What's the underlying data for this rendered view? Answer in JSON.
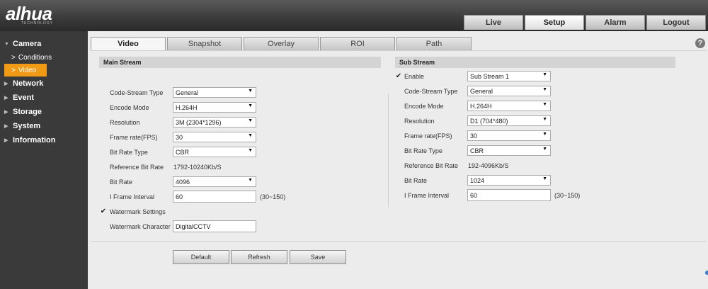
{
  "brand": {
    "name": "alhua",
    "subtitle": "TECHNOLOGY"
  },
  "topnav": [
    "Live",
    "Setup",
    "Alarm",
    "Logout"
  ],
  "sidebar": {
    "camera": "Camera",
    "conditions": "Conditions",
    "video": "Video",
    "network": "Network",
    "event": "Event",
    "storage": "Storage",
    "system": "System",
    "information": "Information"
  },
  "subtabs": [
    "Video",
    "Snapshot",
    "Overlay",
    "ROI",
    "Path"
  ],
  "help": "?",
  "main": {
    "title": "Main Stream",
    "code_stream_type": {
      "label": "Code-Stream Type",
      "value": "General"
    },
    "encode_mode": {
      "label": "Encode Mode",
      "value": "H.264H"
    },
    "resolution": {
      "label": "Resolution",
      "value": "3M (2304*1296)"
    },
    "frame_rate": {
      "label": "Frame rate(FPS)",
      "value": "30"
    },
    "bit_rate_type": {
      "label": "Bit Rate Type",
      "value": "CBR"
    },
    "reference_bit_rate": {
      "label": "Reference Bit Rate",
      "value": "1792-10240Kb/S"
    },
    "bit_rate": {
      "label": "Bit Rate",
      "value": "4096"
    },
    "i_frame": {
      "label": "I Frame Interval",
      "value": "60",
      "hint": "(30~150)"
    },
    "watermark_settings": "Watermark Settings",
    "watermark_character": {
      "label": "Watermark Character",
      "value": "DigitalCCTV"
    }
  },
  "sub": {
    "title": "Sub Stream",
    "enable": {
      "label": "Enable",
      "value": "Sub Stream 1"
    },
    "code_stream_type": {
      "label": "Code-Stream Type",
      "value": "General"
    },
    "encode_mode": {
      "label": "Encode Mode",
      "value": "H.264H"
    },
    "resolution": {
      "label": "Resolution",
      "value": "D1 (704*480)"
    },
    "frame_rate": {
      "label": "Frame rate(FPS)",
      "value": "30"
    },
    "bit_rate_type": {
      "label": "Bit Rate Type",
      "value": "CBR"
    },
    "reference_bit_rate": {
      "label": "Reference Bit Rate",
      "value": "192-4096Kb/S"
    },
    "bit_rate": {
      "label": "Bit Rate",
      "value": "1024"
    },
    "i_frame": {
      "label": "I Frame Interval",
      "value": "60",
      "hint": "(30~150)"
    }
  },
  "buttons": {
    "default": "Default",
    "refresh": "Refresh",
    "save": "Save"
  },
  "check_glyph": "✔",
  "caret_glyph": "▼",
  "arrow_right": "▶",
  "arrow_down": "▼",
  "chevron_right": ">"
}
